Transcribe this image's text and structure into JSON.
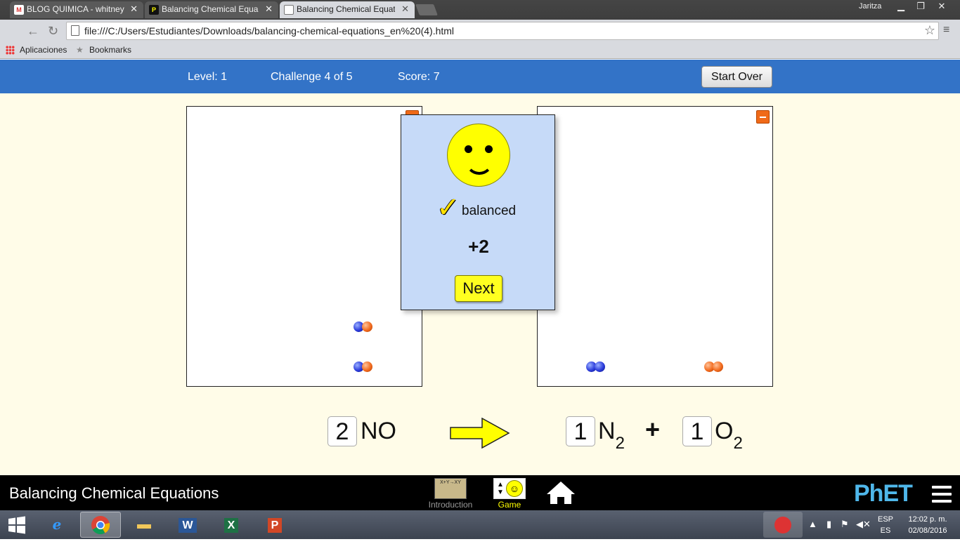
{
  "browser": {
    "tabs": [
      {
        "label": "BLOG QUIMICA - whitney",
        "icon": "gmail-icon"
      },
      {
        "label": "Balancing Chemical Equa",
        "icon": "phet-icon"
      },
      {
        "label": "Balancing Chemical Equat",
        "icon": "page-icon"
      }
    ],
    "user": "Jaritza",
    "url": "file:///C:/Users/Estudiantes/Downloads/balancing-chemical-equations_en%20(4).html",
    "bookmarks": {
      "apps": "Aplicaciones",
      "bookmarks": "Bookmarks"
    }
  },
  "game": {
    "level": "Level: 1",
    "challenge": "Challenge 4 of 5",
    "score": "Score: 7",
    "start_over": "Start Over"
  },
  "feedback": {
    "status": "balanced",
    "points": "+2",
    "next": "Next"
  },
  "equation": {
    "reactants": [
      {
        "coefficient": "2",
        "formula": "NO"
      }
    ],
    "products": [
      {
        "coefficient": "1",
        "symbol": "N",
        "subscript": "2"
      },
      {
        "coefficient": "1",
        "symbol": "O",
        "subscript": "2"
      }
    ],
    "plus": "+"
  },
  "navbar": {
    "title": "Balancing Chemical Equations",
    "screens": [
      {
        "label": "Introduction",
        "thumb_text": "X+Y→XY"
      },
      {
        "label": "Game"
      }
    ],
    "logo": "PhET"
  },
  "taskbar": {
    "lang1": "ESP",
    "lang2": "ES",
    "time": "12:02 p. m.",
    "date": "02/08/2016"
  },
  "colors": {
    "header_blue": "#3373c7",
    "body_bg": "#fffce8",
    "popup_bg": "#c6daf8",
    "nitrogen": "#2b3bdb",
    "oxygen": "#f26a1d",
    "next_button": "#ffff20",
    "game_label": "#ffff00"
  }
}
